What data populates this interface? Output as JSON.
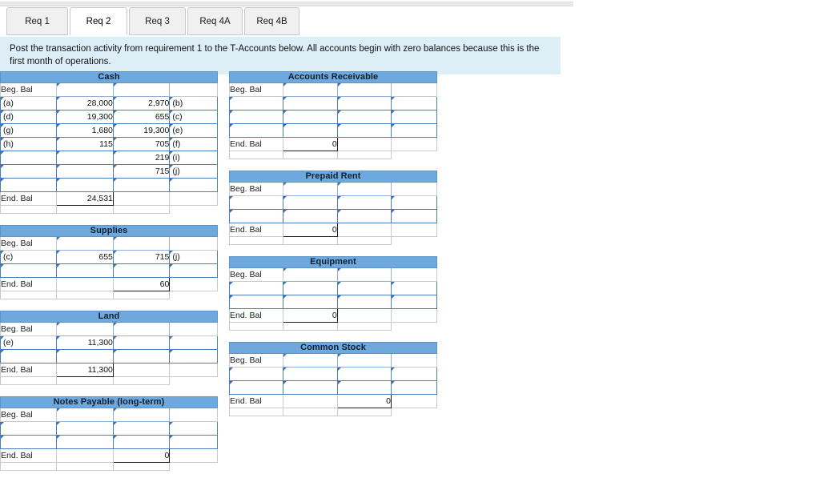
{
  "tabs": {
    "items": [
      {
        "label": "Req 1",
        "active": false
      },
      {
        "label": "Req 2",
        "active": true
      },
      {
        "label": "Req 3",
        "active": false
      },
      {
        "label": "Req 4A",
        "active": false
      },
      {
        "label": "Req 4B",
        "active": false
      }
    ]
  },
  "instruction": {
    "text": "Post the transaction activity from requirement 1 to the T-Accounts below. All accounts begin with zero balances because this is the first month of operations."
  },
  "labels": {
    "beg_bal": "Beg. Bal",
    "end_bal": "End. Bal"
  },
  "colors": {
    "header_blue": "#6fa8dc",
    "banner_blue": "#ddeef7",
    "input_border": "#4a7ebb",
    "tab_inactive": "#f0f0f0",
    "tab_active": "#ffffff"
  },
  "accounts": {
    "cash": {
      "title": "Cash",
      "rows": [
        {
          "ref_left": "(a)",
          "debit": "28,000",
          "credit": "2,970",
          "ref_right": "(b)"
        },
        {
          "ref_left": "(d)",
          "debit": "19,300",
          "credit": "655",
          "ref_right": "(c)"
        },
        {
          "ref_left": "(g)",
          "debit": "1,680",
          "credit": "19,300",
          "ref_right": "(e)"
        },
        {
          "ref_left": "(h)",
          "debit": "115",
          "credit": "705",
          "ref_right": "(f)"
        },
        {
          "ref_left": "",
          "debit": "",
          "credit": "219",
          "ref_right": "(i)"
        },
        {
          "ref_left": "",
          "debit": "",
          "credit": "715",
          "ref_right": "(j)"
        },
        {
          "ref_left": "",
          "debit": "",
          "credit": "",
          "ref_right": ""
        }
      ],
      "end_debit": "24,531",
      "end_credit": ""
    },
    "accounts_receivable": {
      "title": "Accounts Receivable",
      "rows": [
        {
          "ref_left": "",
          "debit": "",
          "credit": "",
          "ref_right": ""
        },
        {
          "ref_left": "",
          "debit": "",
          "credit": "",
          "ref_right": ""
        },
        {
          "ref_left": "",
          "debit": "",
          "credit": "",
          "ref_right": ""
        }
      ],
      "end_debit": "0",
      "end_credit": ""
    },
    "supplies": {
      "title": "Supplies",
      "rows": [
        {
          "ref_left": "(c)",
          "debit": "655",
          "credit": "715",
          "ref_right": "(j)"
        },
        {
          "ref_left": "",
          "debit": "",
          "credit": "",
          "ref_right": ""
        }
      ],
      "end_debit": "",
      "end_credit": "60"
    },
    "prepaid_rent": {
      "title": "Prepaid Rent",
      "rows": [
        {
          "ref_left": "",
          "debit": "",
          "credit": "",
          "ref_right": ""
        },
        {
          "ref_left": "",
          "debit": "",
          "credit": "",
          "ref_right": ""
        }
      ],
      "end_debit": "0",
      "end_credit": ""
    },
    "land": {
      "title": "Land",
      "rows": [
        {
          "ref_left": "(e)",
          "debit": "11,300",
          "credit": "",
          "ref_right": ""
        },
        {
          "ref_left": "",
          "debit": "",
          "credit": "",
          "ref_right": ""
        }
      ],
      "end_debit": "11,300",
      "end_credit": ""
    },
    "equipment": {
      "title": "Equipment",
      "rows": [
        {
          "ref_left": "",
          "debit": "",
          "credit": "",
          "ref_right": ""
        },
        {
          "ref_left": "",
          "debit": "",
          "credit": "",
          "ref_right": ""
        }
      ],
      "end_debit": "0",
      "end_credit": ""
    },
    "notes_payable": {
      "title": "Notes Payable (long-term)",
      "rows": [
        {
          "ref_left": "",
          "debit": "",
          "credit": "",
          "ref_right": ""
        },
        {
          "ref_left": "",
          "debit": "",
          "credit": "",
          "ref_right": ""
        }
      ],
      "end_debit": "",
      "end_credit": "0"
    },
    "common_stock": {
      "title": "Common Stock",
      "rows": [
        {
          "ref_left": "",
          "debit": "",
          "credit": "",
          "ref_right": ""
        },
        {
          "ref_left": "",
          "debit": "",
          "credit": "",
          "ref_right": ""
        }
      ],
      "end_debit": "",
      "end_credit": "0"
    }
  }
}
